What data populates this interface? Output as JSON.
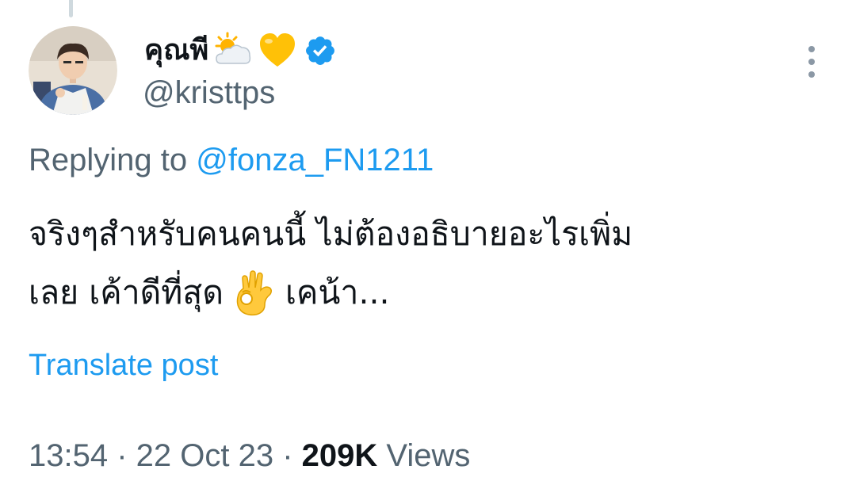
{
  "author": {
    "display_name": "คุณพี",
    "name_emojis": [
      "sun-behind-cloud-emoji",
      "yellow-heart-emoji"
    ],
    "verified": true,
    "handle": "@kristtps"
  },
  "reply": {
    "prefix": "Replying to ",
    "to_handle": "@fonza_FN1211"
  },
  "text": {
    "line1": "จริงๆสำหรับคนคนนี้ ไม่ต้องอธิบายอะไรเพิ่ม",
    "line2_before_emoji": "เลย เค้าดีที่สุด",
    "line2_emoji": "ok-hand-emoji",
    "line2_after_emoji": "เคน้า..."
  },
  "translate_label": "Translate post",
  "meta": {
    "time": "13:54",
    "separator": " · ",
    "date": "22 Oct 23",
    "views_count": "209K",
    "views_label": " Views"
  },
  "colors": {
    "text_primary": "#0f1419",
    "text_secondary": "#536471",
    "link": "#1d9bf0",
    "verified_badge": "#1d9bf0"
  }
}
